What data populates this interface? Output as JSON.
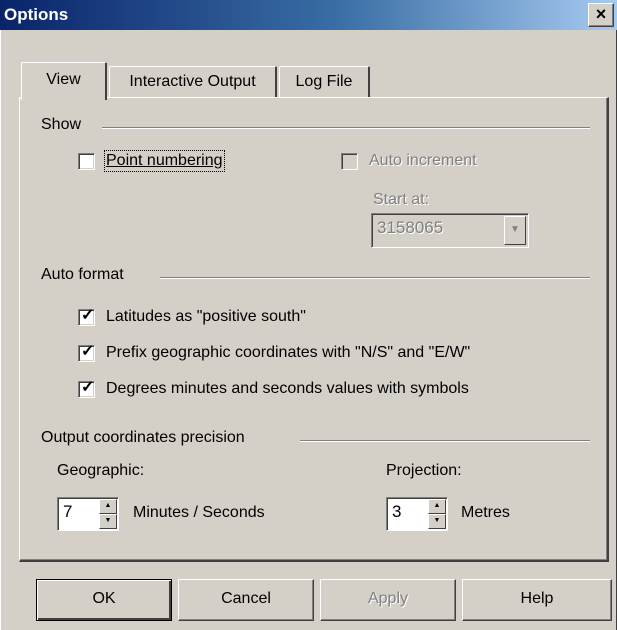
{
  "window": {
    "title": "Options",
    "close_glyph": "×"
  },
  "tabs": [
    {
      "label": "View",
      "active": true
    },
    {
      "label": "Interactive Output",
      "active": false
    },
    {
      "label": "Log File",
      "active": false
    }
  ],
  "show": {
    "title": "Show",
    "point_numbering": {
      "label": "Point numbering",
      "checked": false
    },
    "auto_increment": {
      "label": "Auto increment",
      "checked": false,
      "disabled": true
    },
    "start_at": {
      "label": "Start at:",
      "value": "3158065",
      "disabled": true
    }
  },
  "auto_format": {
    "title": "Auto format",
    "latitudes": {
      "label": "Latitudes as \"positive south\"",
      "checked": true
    },
    "prefix": {
      "label": "Prefix geographic coordinates with \"N/S\" and \"E/W\"",
      "checked": true
    },
    "degrees": {
      "label": "Degrees minutes and seconds values with symbols",
      "checked": true
    }
  },
  "precision": {
    "title": "Output coordinates precision",
    "geographic": {
      "label": "Geographic:",
      "value": "7",
      "unit": "Minutes / Seconds"
    },
    "projection": {
      "label": "Projection:",
      "value": "3",
      "unit": "Metres"
    }
  },
  "buttons": {
    "ok": "OK",
    "cancel": "Cancel",
    "apply": "Apply",
    "help": "Help"
  },
  "icons": {
    "check": "check-mark-icon",
    "up": "spin-up-icon",
    "down": "spin-down-icon",
    "dropdown": "dropdown-arrow-icon"
  }
}
